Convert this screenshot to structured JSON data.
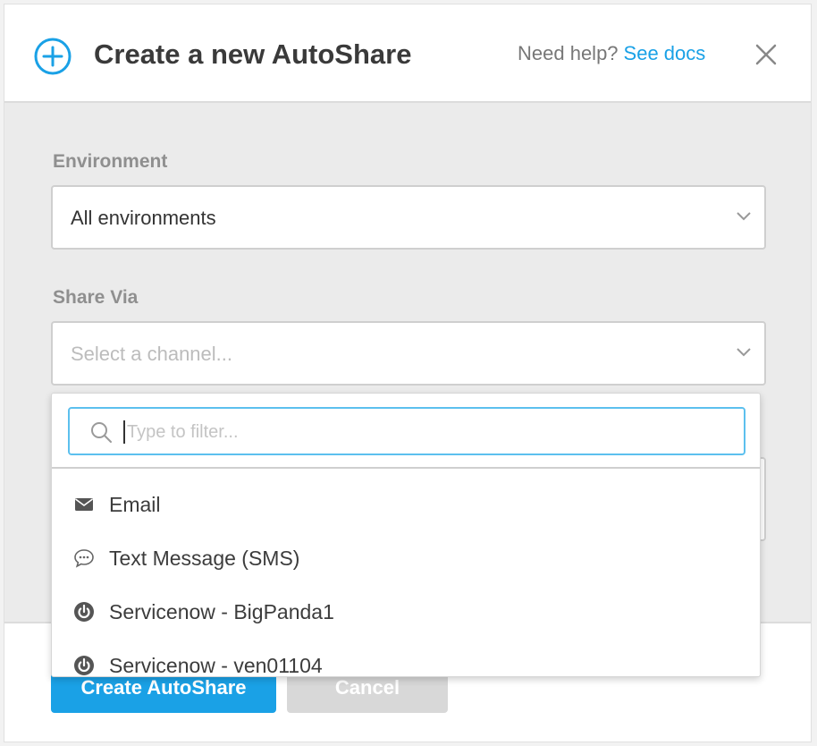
{
  "header": {
    "title": "Create a new AutoShare",
    "help_text": "Need help?",
    "help_link": "See docs"
  },
  "environment": {
    "label": "Environment",
    "value": "All environments"
  },
  "share_via": {
    "label": "Share Via",
    "placeholder": "Select a channel..."
  },
  "dropdown": {
    "filter_placeholder": "Type to filter...",
    "options": [
      {
        "label": "Email",
        "icon": "envelope-icon"
      },
      {
        "label": "Text Message (SMS)",
        "icon": "chat-bubble-icon"
      },
      {
        "label": "Servicenow - BigPanda1",
        "icon": "power-icon"
      },
      {
        "label": "Servicenow - ven01104",
        "icon": "power-icon"
      }
    ]
  },
  "footer": {
    "create_label": "Create AutoShare",
    "cancel_label": "Cancel"
  },
  "colors": {
    "accent": "#1aa1e6",
    "title": "#3a3a3a",
    "muted_label": "#8f8f8f",
    "disabled_button": "#d8d8d8"
  }
}
